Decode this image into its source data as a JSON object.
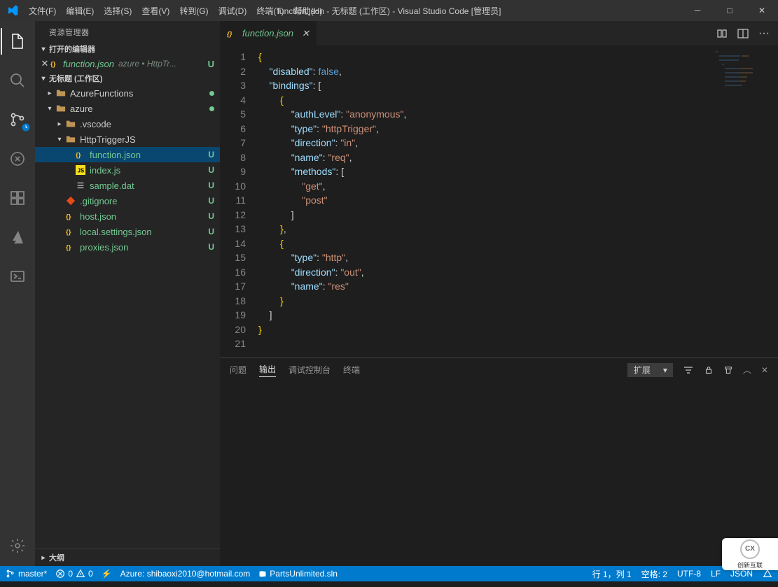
{
  "window": {
    "title": "function.json - 无标题 (工作区) - Visual Studio Code [管理员]",
    "menu": [
      "文件(F)",
      "编辑(E)",
      "选择(S)",
      "查看(V)",
      "转到(G)",
      "调试(D)",
      "终端(T)",
      "帮助(H)"
    ]
  },
  "sidebar": {
    "title": "资源管理器",
    "sections": {
      "openEditors": "打开的编辑器",
      "workspace": "无标题 (工作区)",
      "outline": "大纲"
    },
    "openEditorItem": {
      "name": "function.json",
      "path": "azure • HttpTr...",
      "badge": "U"
    },
    "tree": [
      {
        "label": "AzureFunctions",
        "type": "folder",
        "depth": 1,
        "open": false,
        "dot": true
      },
      {
        "label": "azure",
        "type": "folder",
        "depth": 1,
        "open": true,
        "dot": true
      },
      {
        "label": ".vscode",
        "type": "folder",
        "depth": 2,
        "open": false
      },
      {
        "label": "HttpTriggerJS",
        "type": "folder",
        "depth": 2,
        "open": true
      },
      {
        "label": "function.json",
        "type": "json",
        "depth": 3,
        "badge": "U",
        "selected": true
      },
      {
        "label": "index.js",
        "type": "js",
        "depth": 3,
        "badge": "U"
      },
      {
        "label": "sample.dat",
        "type": "dat",
        "depth": 3,
        "badge": "U"
      },
      {
        "label": ".gitignore",
        "type": "git",
        "depth": 2,
        "badge": "U"
      },
      {
        "label": "host.json",
        "type": "json",
        "depth": 2,
        "badge": "U"
      },
      {
        "label": "local.settings.json",
        "type": "json",
        "depth": 2,
        "badge": "U"
      },
      {
        "label": "proxies.json",
        "type": "json",
        "depth": 2,
        "badge": "U"
      }
    ]
  },
  "tab": {
    "name": "function.json"
  },
  "code": {
    "lines": [
      [
        [
          "brace",
          "{"
        ]
      ],
      [
        [
          "t",
          "    "
        ],
        [
          "key",
          "\"disabled\""
        ],
        [
          "p",
          ": "
        ],
        [
          "false",
          "false"
        ],
        [
          "p",
          ","
        ]
      ],
      [
        [
          "t",
          "    "
        ],
        [
          "key",
          "\"bindings\""
        ],
        [
          "p",
          ": ["
        ]
      ],
      [
        [
          "t",
          "        "
        ],
        [
          "brace",
          "{"
        ]
      ],
      [
        [
          "t",
          "            "
        ],
        [
          "key",
          "\"authLevel\""
        ],
        [
          "p",
          ": "
        ],
        [
          "str",
          "\"anonymous\""
        ],
        [
          "p",
          ","
        ]
      ],
      [
        [
          "t",
          "            "
        ],
        [
          "key",
          "\"type\""
        ],
        [
          "p",
          ": "
        ],
        [
          "str",
          "\"httpTrigger\""
        ],
        [
          "p",
          ","
        ]
      ],
      [
        [
          "t",
          "            "
        ],
        [
          "key",
          "\"direction\""
        ],
        [
          "p",
          ": "
        ],
        [
          "str",
          "\"in\""
        ],
        [
          "p",
          ","
        ]
      ],
      [
        [
          "t",
          "            "
        ],
        [
          "key",
          "\"name\""
        ],
        [
          "p",
          ": "
        ],
        [
          "str",
          "\"req\""
        ],
        [
          "p",
          ","
        ]
      ],
      [
        [
          "t",
          "            "
        ],
        [
          "key",
          "\"methods\""
        ],
        [
          "p",
          ": ["
        ]
      ],
      [
        [
          "t",
          "                "
        ],
        [
          "str",
          "\"get\""
        ],
        [
          "p",
          ","
        ]
      ],
      [
        [
          "t",
          "                "
        ],
        [
          "str",
          "\"post\""
        ]
      ],
      [
        [
          "t",
          "            "
        ],
        [
          "p",
          "]"
        ]
      ],
      [
        [
          "t",
          "        "
        ],
        [
          "brace",
          "}"
        ],
        [
          "p",
          ","
        ]
      ],
      [
        [
          "t",
          "        "
        ],
        [
          "brace",
          "{"
        ]
      ],
      [
        [
          "t",
          "            "
        ],
        [
          "key",
          "\"type\""
        ],
        [
          "p",
          ": "
        ],
        [
          "str",
          "\"http\""
        ],
        [
          "p",
          ","
        ]
      ],
      [
        [
          "t",
          "            "
        ],
        [
          "key",
          "\"direction\""
        ],
        [
          "p",
          ": "
        ],
        [
          "str",
          "\"out\""
        ],
        [
          "p",
          ","
        ]
      ],
      [
        [
          "t",
          "            "
        ],
        [
          "key",
          "\"name\""
        ],
        [
          "p",
          ": "
        ],
        [
          "str",
          "\"res\""
        ]
      ],
      [
        [
          "t",
          "        "
        ],
        [
          "brace",
          "}"
        ]
      ],
      [
        [
          "t",
          "    "
        ],
        [
          "p",
          "]"
        ]
      ],
      [
        [
          "brace",
          "}"
        ]
      ],
      [
        [
          "t",
          ""
        ]
      ]
    ]
  },
  "panel": {
    "tabs": [
      "问题",
      "输出",
      "调试控制台",
      "终端"
    ],
    "activeTab": 1,
    "select": "扩展"
  },
  "status": {
    "branch": "master*",
    "errors": "0",
    "warnings": "0",
    "azure": "Azure: shibaoxi2010@hotmail.com",
    "solution": "PartsUnlimited.sln",
    "position": "行 1，列 1",
    "spaces": "空格: 2",
    "encoding": "UTF-8",
    "eol": "LF",
    "lang": "JSON"
  },
  "watermark": "创新互联"
}
